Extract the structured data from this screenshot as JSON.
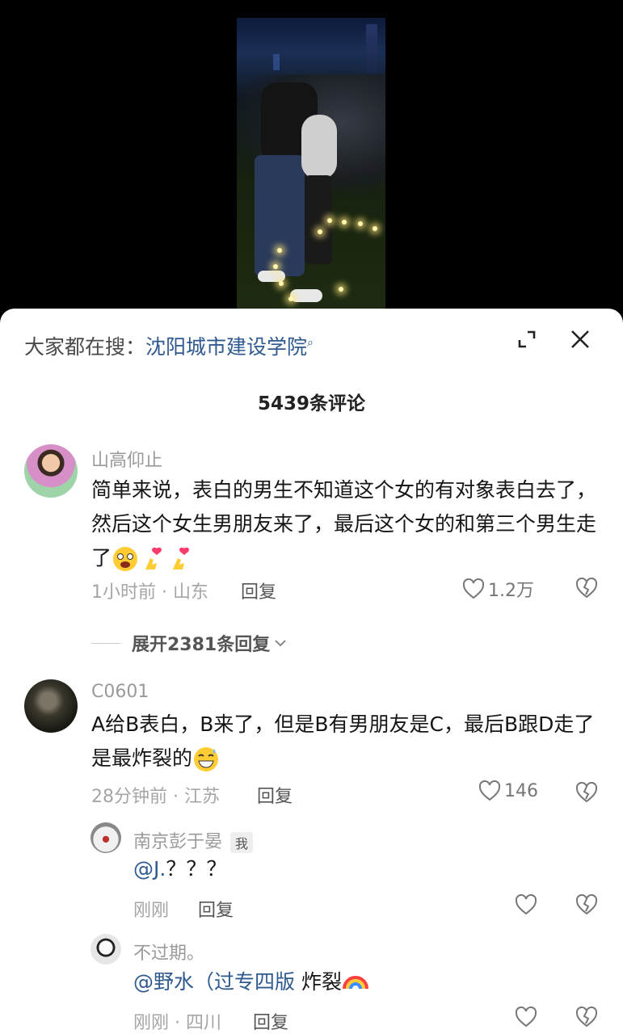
{
  "search": {
    "label": "大家都在搜：",
    "keyword": "沈阳城市建设学院"
  },
  "comments_count": "5439条评论",
  "comments": [
    {
      "user": "山高仰止",
      "text": "简单来说，表白的男生不知道这个女的有对象表白去了，然后这个女生男朋友来了，最后这个女的和第三个男生走了",
      "emojis": [
        "scared-face-icon",
        "heart-finger-icon",
        "heart-finger-icon"
      ],
      "meta": "1小时前 · 山东",
      "reply_label": "回复",
      "likes": "1.2万",
      "expand_label": "展开2381条回复"
    },
    {
      "user": "C0601",
      "text": "A给B表白，B来了，但是B有男朋友是C，最后B跟D走了是最炸裂的",
      "emojis": [
        "grinning-sweat-icon"
      ],
      "meta": "28分钟前 · 江苏",
      "reply_label": "回复",
      "likes": "146"
    }
  ],
  "replies": [
    {
      "user": "南京彭于晏",
      "badge": "我",
      "text_mention": "@J.",
      "text": "？？？",
      "meta": "刚刚",
      "reply_label": "回复"
    },
    {
      "user": "不过期。",
      "text_mention": "@野水（过专四版",
      "text": " 炸裂",
      "emojis": [
        "rainbow-icon"
      ],
      "meta": "刚刚 · 四川",
      "reply_label": "回复"
    }
  ],
  "colors": {
    "accent": "#2f5a8f",
    "text": "#161616",
    "muted": "#9a9a9a"
  }
}
